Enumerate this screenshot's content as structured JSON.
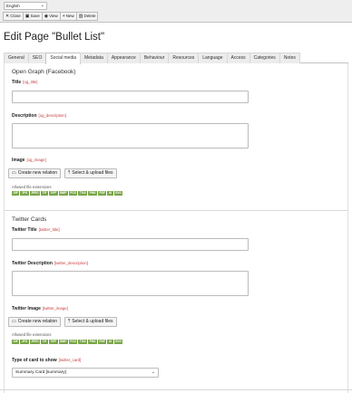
{
  "header": {
    "language": "English",
    "toolbar": [
      {
        "icon": "close-icon",
        "glyph": "✕",
        "label": "Close"
      },
      {
        "icon": "save-icon",
        "glyph": "▣",
        "label": "Save"
      },
      {
        "icon": "view-icon",
        "glyph": "◉",
        "label": "View"
      },
      {
        "icon": "plus-icon",
        "glyph": "+",
        "label": "New"
      },
      {
        "icon": "trash-icon",
        "glyph": "▥",
        "label": "Delete"
      }
    ]
  },
  "page_title": "Edit Page \"Bullet List\"",
  "tabs": [
    "General",
    "SEO",
    "Social media",
    "Metadata",
    "Appearance",
    "Behaviour",
    "Resources",
    "Language",
    "Access",
    "Categories",
    "Notes"
  ],
  "active_tab": "Social media",
  "og": {
    "section_title": "Open Graph (Facebook)",
    "title_label": "Title",
    "title_code": "[og_title]",
    "description_label": "Description",
    "description_code": "[og_description]",
    "image_label": "Image",
    "image_code": "[og_image]",
    "create_relation": "Create new relation",
    "select_upload": "Select & upload files",
    "allowed_ext": "Allowed file extensions",
    "extensions": [
      "GIF",
      "JPG",
      "JPEG",
      "TIF",
      "TIFF",
      "BMP",
      "PCX",
      "TGA",
      "PNG",
      "PDF",
      "AI",
      "SVG"
    ]
  },
  "twitter": {
    "section_title": "Twitter Cards",
    "title_label": "Twitter Title",
    "title_code": "[twitter_title]",
    "description_label": "Twitter Description",
    "description_code": "[twitter_description]",
    "image_label": "Twitter Image",
    "image_code": "[twitter_image]",
    "create_relation": "Create new relation",
    "select_upload": "Select & upload files",
    "allowed_ext": "Allowed file extensions",
    "extensions": [
      "GIF",
      "JPG",
      "JPEG",
      "TIF",
      "TIFF",
      "BMP",
      "PCX",
      "TGA",
      "PNG",
      "PDF",
      "AI",
      "SVG"
    ],
    "card_label": "Type of card to show",
    "card_code": "[twitter_card]",
    "card_value": "Summary Card [summary]"
  },
  "colors": {
    "ext_badge": "#79a548",
    "code_label": "#c83c3c",
    "toolbar_bg": "#eeeeee"
  }
}
